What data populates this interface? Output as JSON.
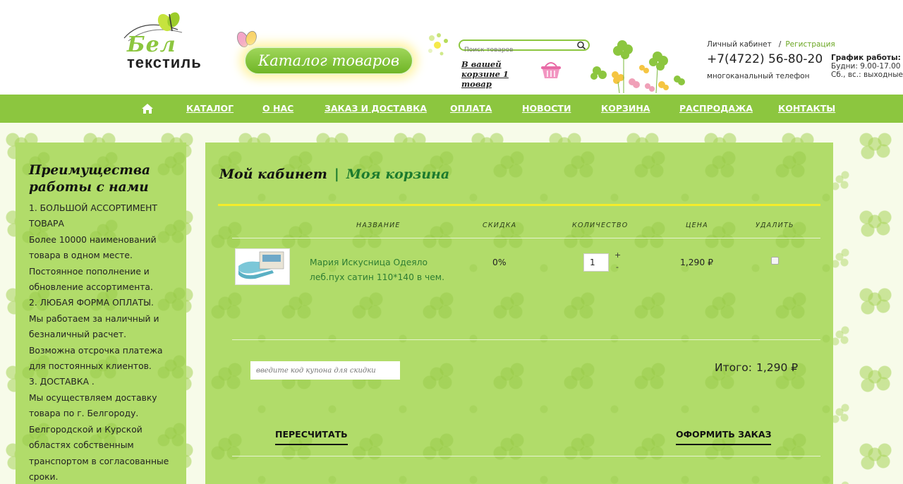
{
  "header": {
    "logo_top": "Бел",
    "logo_bottom": "текстиль",
    "catalog_button": "Каталог товаров",
    "search_placeholder": "Поиск товаров",
    "cart_info": "В вашей корзине 1 товар",
    "account_link": "Личный кабинет",
    "separator": "/",
    "register_link": "Регистрация",
    "phone": "+7(4722) 56-80-20",
    "phone_note": "многоканальный телефон",
    "schedule_title": "График работы:",
    "schedule_weekdays": "Будни: 9.00-17.00",
    "schedule_weekend": "Сб., вс.: выходные"
  },
  "nav": {
    "items": [
      "КАТАЛОГ",
      "О НАС",
      "ЗАКАЗ И ДОСТАВКА",
      "ОПЛАТА",
      "НОВОСТИ",
      "КОРЗИНА",
      "РАСПРОДАЖА",
      "КОНТАКТЫ"
    ]
  },
  "sidebar": {
    "title": "Преимущества работы с нами",
    "lines": [
      "1. БОЛЬШОЙ АССОРТИМЕНТ",
      "ТОВАРА",
      "Более 10000 наименований",
      "товара в одном месте.",
      "Постоянное пополнение и",
      "обновление ассортимента.",
      "2. ЛЮБАЯ ФОРМА ОПЛАТЫ.",
      "Мы работаем за наличный и",
      "безналичный расчет.",
      "Возможна отсрочка платежа",
      "для постоянных клиентов.",
      "3. ДОСТАВКА .",
      "Мы осуществляем доставку",
      "товара по г. Белгороду.",
      "Белгородской и Курской",
      "областях собственным",
      "транспортом в согласованные",
      "сроки."
    ]
  },
  "main": {
    "breadcrumb_cabinet": "Мой кабинет",
    "breadcrumb_sep": "|",
    "breadcrumb_cart": "Моя корзина",
    "columns": [
      "НАЗВАНИЕ",
      "СКИДКА",
      "КОЛИЧЕСТВО",
      "ЦЕНА",
      "УДАЛИТЬ"
    ],
    "item": {
      "name": "Мария Искусница Одеяло леб.пух сатин 110*140 в чем.",
      "image_caption": "Мария Искусница",
      "discount": "0%",
      "quantity": "1",
      "plus": "+",
      "minus": "-",
      "price": "1,290 ₽"
    },
    "coupon_placeholder": "введите код купона для скидки",
    "total_label": "Итого:",
    "total_value": "1,290 ₽",
    "recalc_button": "ПЕРЕСЧИТАТЬ",
    "checkout_button": "ОФОРМИТЬ ЗАКАЗ"
  },
  "colors": {
    "brand_green": "#8cc63f",
    "panel_green": "#b1dc6a",
    "accent_dark_green": "#1b7a2e",
    "accent_yellow": "#f4ec2a",
    "basket_pink": "#e86aa6"
  }
}
